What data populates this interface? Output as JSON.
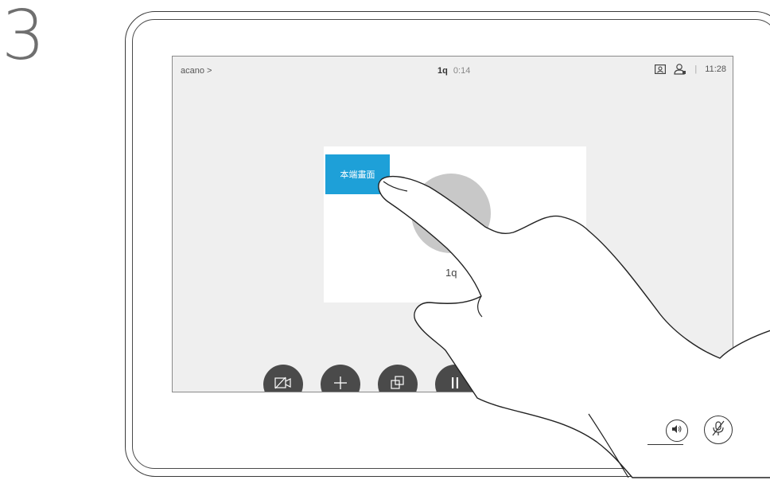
{
  "step": {
    "number": "3"
  },
  "screen": {
    "breadcrumb": "acano >",
    "call": {
      "name": "1q",
      "timer": "0:14"
    },
    "status": {
      "separator": "|",
      "clock": "11:28"
    },
    "self_view_button": "本端畫面",
    "participant": "1q",
    "controls": [
      "camera-off-icon",
      "plus-icon",
      "layout-icon",
      "pause-icon"
    ]
  },
  "colors": {
    "accent": "#1ea0d8",
    "screen_bg": "#efefef",
    "control_bg": "#4a4a4a"
  },
  "device_buttons": [
    "volume-icon",
    "mic-mute-icon"
  ]
}
